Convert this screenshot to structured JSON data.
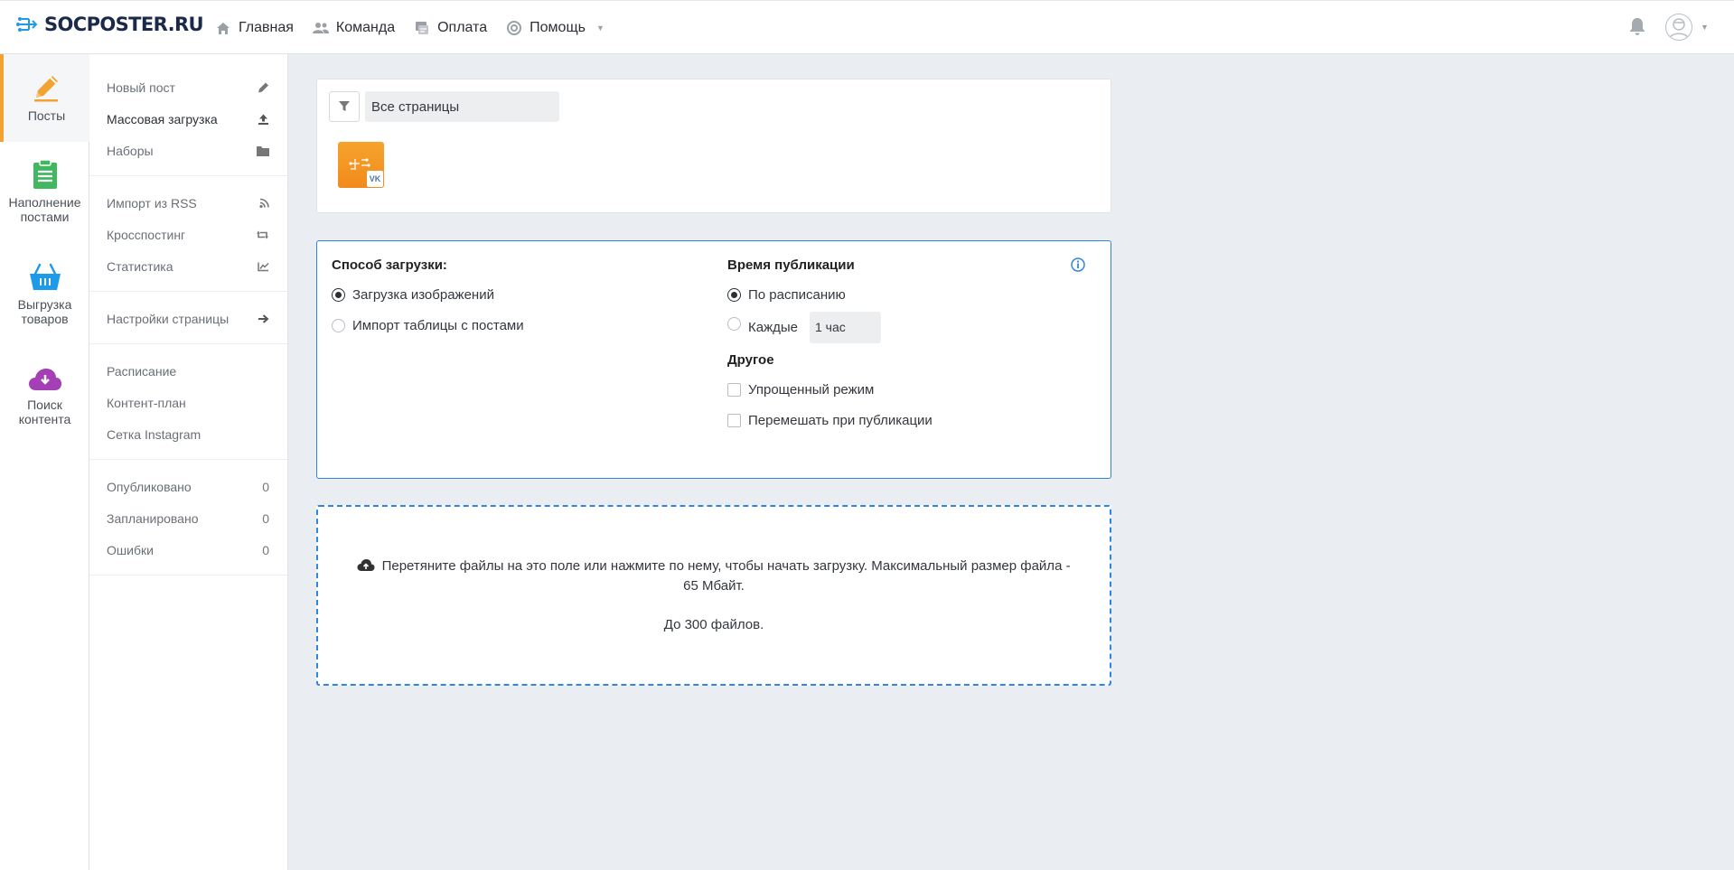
{
  "brand": {
    "logo_text": "SOCPOSTER.RU"
  },
  "nav": {
    "items": [
      {
        "label": "Главная",
        "icon": "home-icon"
      },
      {
        "label": "Команда",
        "icon": "users-icon"
      },
      {
        "label": "Оплата",
        "icon": "payment-icon"
      },
      {
        "label": "Помощь",
        "icon": "lifebuoy-icon"
      }
    ]
  },
  "rail": {
    "items": [
      {
        "label": "Посты",
        "icon": "pencil-icon",
        "color": "#f2a230"
      },
      {
        "label": "Наполнение постами",
        "icon": "clipboard-icon",
        "color": "#3fb85f"
      },
      {
        "label": "Выгрузка товаров",
        "icon": "basket-icon",
        "color": "#1e9be8"
      },
      {
        "label": "Поиск контента",
        "icon": "cloud-download-icon",
        "color": "#a43fb5"
      }
    ]
  },
  "sub": {
    "g1": [
      {
        "label": "Новый пост",
        "icon": "pencil-icon"
      },
      {
        "label": "Массовая загрузка",
        "icon": "upload-icon"
      },
      {
        "label": "Наборы",
        "icon": "folder-icon"
      }
    ],
    "g2": [
      {
        "label": "Импорт из RSS",
        "icon": "rss-icon"
      },
      {
        "label": "Кросспостинг",
        "icon": "retweet-icon"
      },
      {
        "label": "Статистика",
        "icon": "chart-icon"
      }
    ],
    "g3": [
      {
        "label": "Настройки страницы",
        "icon": "arrow-right-icon"
      }
    ],
    "g4": [
      {
        "label": "Расписание"
      },
      {
        "label": "Контент-план"
      },
      {
        "label": "Сетка Instagram"
      }
    ],
    "g5": [
      {
        "label": "Опубликовано",
        "count": "0"
      },
      {
        "label": "Запланировано",
        "count": "0"
      },
      {
        "label": "Ошибки",
        "count": "0"
      }
    ]
  },
  "filter": {
    "value": "Все страницы",
    "page_badge": "VK"
  },
  "upload": {
    "method_title": "Способ загрузки:",
    "methods": [
      "Загрузка изображений",
      "Импорт таблицы с постами"
    ],
    "time_title": "Время публикации",
    "times": [
      "По расписанию",
      "Каждые"
    ],
    "every_value": "1 час",
    "other_title": "Другое",
    "others": [
      "Упрощенный режим",
      "Перемешать при публикации"
    ]
  },
  "dropzone": {
    "text": "Перетяните файлы на это поле или нажмите по нему, чтобы начать загрузку. Максимальный размер файла - 65 Мбайт.",
    "limit": "До 300 файлов."
  },
  "colors": {
    "accent": "#2f86e0",
    "active_rail": "#f2a230"
  }
}
